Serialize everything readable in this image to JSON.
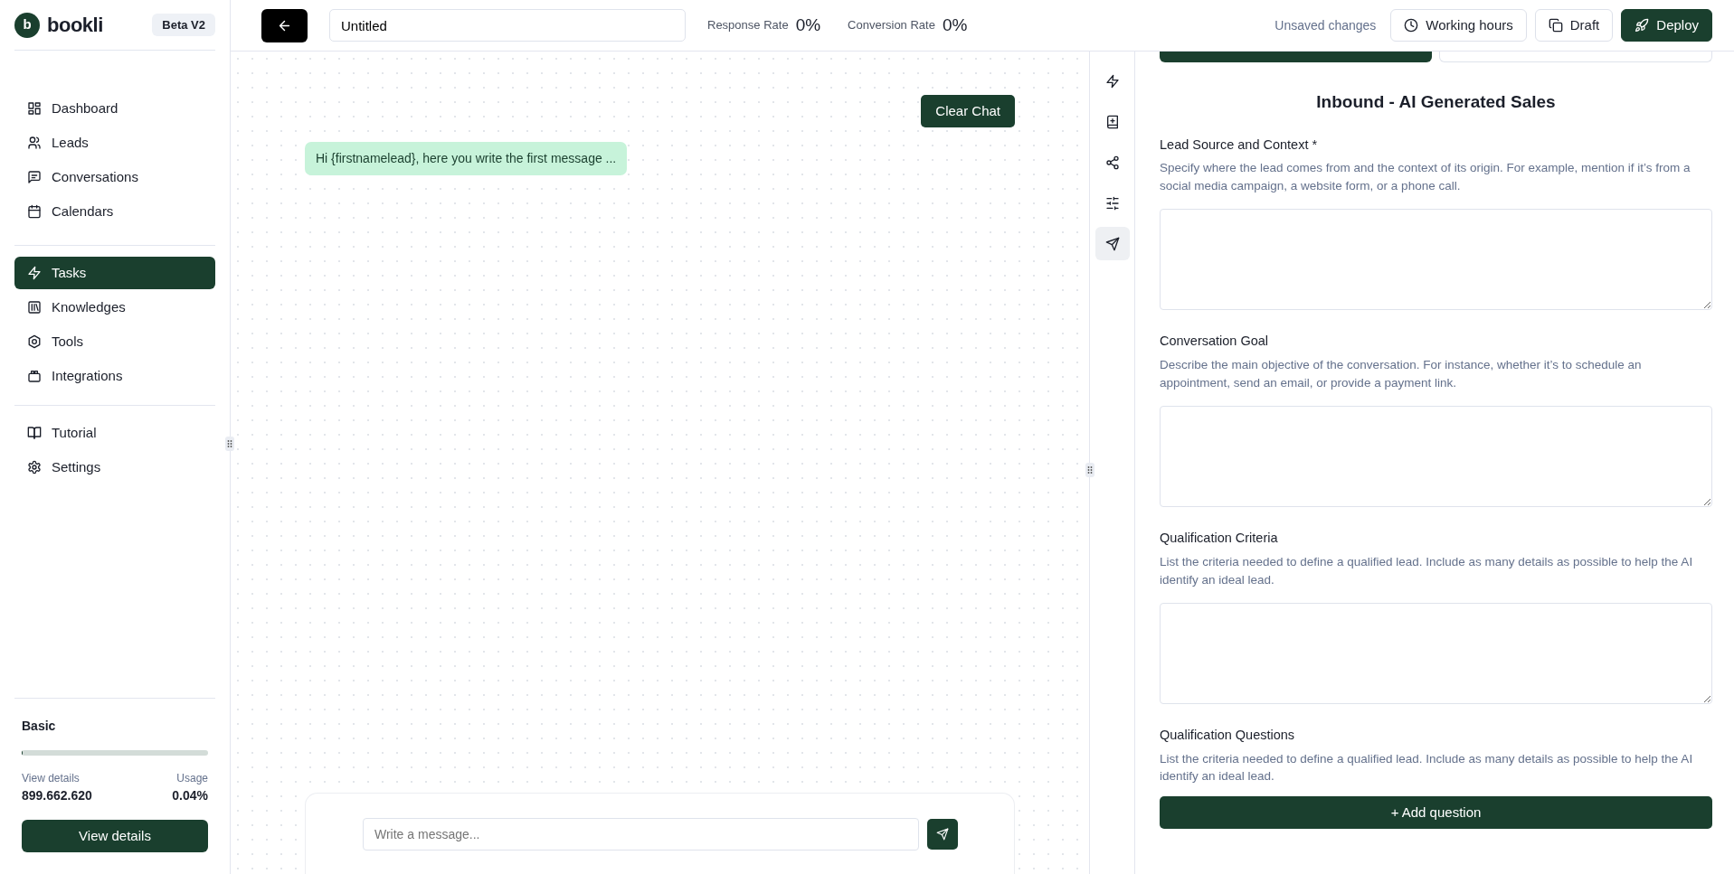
{
  "sidebar": {
    "logo": "b",
    "brand": "bookli",
    "badge": "Beta V2",
    "nav_groups": [
      [
        {
          "label": "Dashboard",
          "selected": false
        },
        {
          "label": "Leads",
          "selected": false
        },
        {
          "label": "Conversations",
          "selected": false
        },
        {
          "label": "Calendars",
          "selected": false
        }
      ],
      [
        {
          "label": "Tasks",
          "selected": true
        },
        {
          "label": "Knowledges",
          "selected": false
        },
        {
          "label": "Tools",
          "selected": false
        },
        {
          "label": "Integrations",
          "selected": false
        }
      ],
      [
        {
          "label": "Tutorial",
          "selected": false
        },
        {
          "label": "Settings",
          "selected": false
        }
      ]
    ],
    "plan": {
      "name": "Basic",
      "level": 0.0004,
      "details_label": "View details",
      "count": "899.662.620",
      "usage_label": "Usage",
      "usage": "0.04%",
      "button": "View details"
    }
  },
  "header": {
    "title_value": "Untitled",
    "metrics": [
      {
        "label": "Response Rate",
        "value": "0%"
      },
      {
        "label": "Conversion Rate",
        "value": "0%"
      }
    ],
    "status": "Unsaved changes",
    "buttons": [
      {
        "label": "Working hours",
        "kind": "outline"
      },
      {
        "label": "Draft",
        "kind": "outline"
      },
      {
        "label": "Deploy",
        "kind": "primary"
      }
    ]
  },
  "chat": {
    "clear_button": "Clear Chat",
    "messages": [
      {
        "text": "Hi {firstnamelead}, here you write the first message ..."
      }
    ],
    "input": {
      "placeholder": "Write a message..."
    }
  },
  "tool_rail": [
    {
      "selected": false
    },
    {
      "selected": false
    },
    {
      "selected": false
    },
    {
      "selected": false
    },
    {
      "selected": true
    }
  ],
  "editor": {
    "tabs": [
      {
        "selected": true
      },
      {
        "selected": false
      }
    ],
    "title": "Inbound - AI Generated Sales",
    "fields": [
      {
        "kind": "textarea",
        "label": "Lead Source and Context *",
        "description": "Specify where the lead comes from and the context of its origin. For example, mention if it’s from a social media campaign, a website form, or a phone call."
      },
      {
        "kind": "textarea",
        "label": "Conversation Goal",
        "description": "Describe the main objective of the conversation. For instance, whether it’s to schedule an appointment, send an email, or provide a payment link."
      },
      {
        "kind": "textarea",
        "label": "Qualification Criteria",
        "description": "List the criteria needed to define a qualified lead. Include as many details as possible to help the AI identify an ideal lead."
      },
      {
        "kind": "questions",
        "label": "Qualification Questions",
        "description": "List the criteria needed to define a qualified lead. Include as many details as possible to help the AI identify an ideal lead.",
        "button": "+ Add question"
      }
    ]
  }
}
